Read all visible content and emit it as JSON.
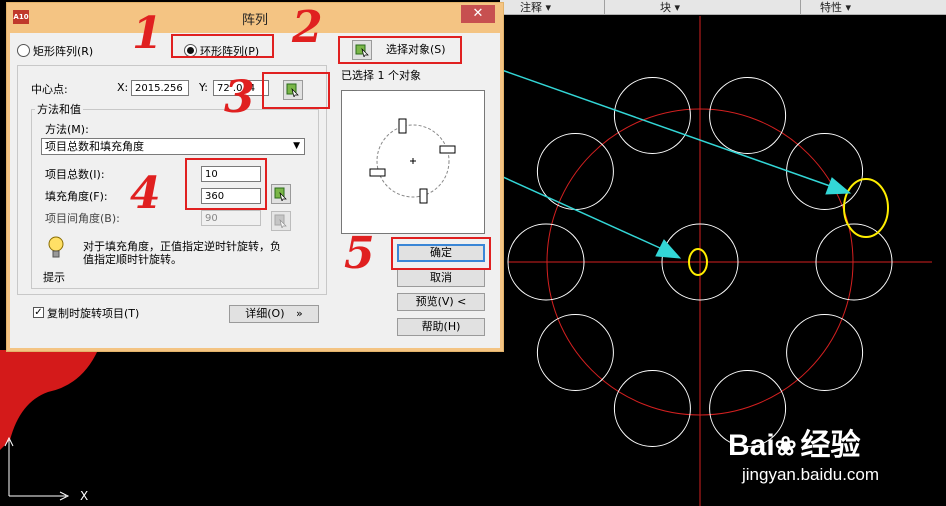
{
  "ribbon": {
    "items": [
      "注释 ▾",
      "块 ▾",
      "特性 ▾"
    ]
  },
  "dialog": {
    "title": "阵列",
    "close_glyph": "✕",
    "app_icon": "A10",
    "rect_array": "矩形阵列(R)",
    "polar_array": "环形阵列(P)",
    "select_objects": "选择对象(S)",
    "selected_count": "已选择 1 个对象",
    "center_point": "中心点:",
    "x_label": "X:",
    "x_value": "2015.256",
    "y_label": "Y:",
    "y_value": "72 .014",
    "method_group": "方法和值",
    "method_label": "方法(M):",
    "method_value": "项目总数和填充角度",
    "total_items_label": "项目总数(I):",
    "total_items_value": "10",
    "fill_angle_label": "填充角度(F):",
    "fill_angle_value": "360",
    "between_angle_label": "项目间角度(B):",
    "between_angle_value": "90",
    "hint_text_1": "对于填充角度，正值指定逆时针旋转，负",
    "hint_text_2": "值指定顺时针旋转。",
    "hint_label": "提示",
    "rotate_items": "复制时旋转项目(T)",
    "details": "详细(O)",
    "details_glyph": "»",
    "ok": "确定",
    "cancel": "取消",
    "preview_btn": "预览(V) <",
    "help": "帮助(H)"
  },
  "annotations": [
    "1",
    "2",
    "3",
    "4",
    "5"
  ],
  "axis": {
    "x": "X"
  },
  "watermark": {
    "brand_1": "Bai",
    "brand_2": "经验",
    "url": "jingyan.baidu.com"
  },
  "colors": {
    "accent_red": "#e02020",
    "cyan_arrow": "#33d6d6",
    "yellow_marker": "#ffee00",
    "circle_red": "#d42020"
  }
}
